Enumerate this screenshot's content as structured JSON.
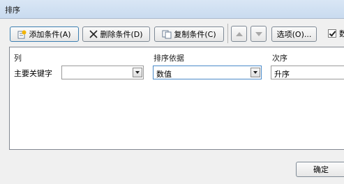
{
  "window": {
    "title": "排序"
  },
  "toolbar": {
    "add_label": "添加条件(A)",
    "delete_label": "删除条件(D)",
    "copy_label": "复制条件(C)",
    "options_label": "选项(O)...",
    "icons": {
      "add": "add-condition-icon",
      "delete": "delete-x-icon",
      "copy": "copy-icon",
      "up": "move-up-icon",
      "down": "move-down-icon"
    }
  },
  "header_checkbox": {
    "checked": true,
    "label": "数"
  },
  "columns": {
    "column": "列",
    "sort_on": "排序依据",
    "order": "次序"
  },
  "rows": [
    {
      "label": "主要关键字",
      "column_value": "",
      "sort_on_value": "数值",
      "order_value": "升序"
    }
  ],
  "footer": {
    "ok_label": "确定"
  }
}
